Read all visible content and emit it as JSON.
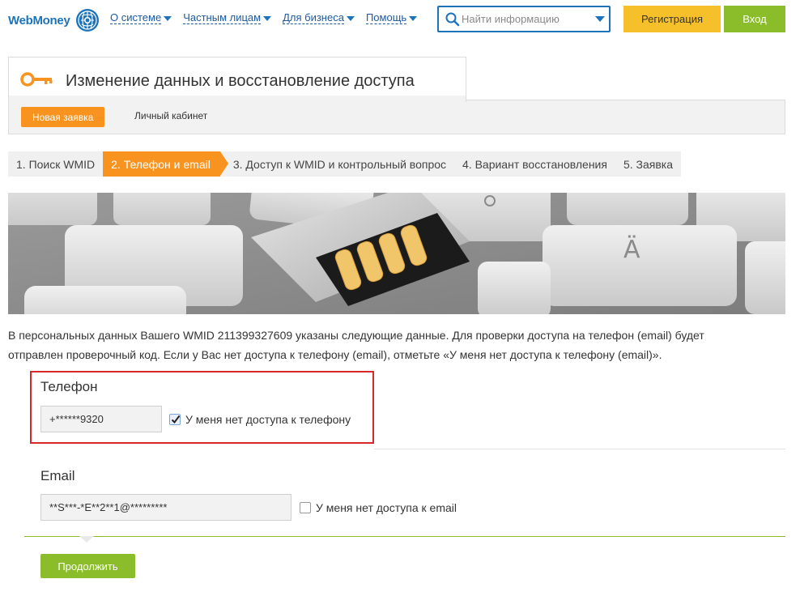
{
  "header": {
    "logo_text": "WebMoney",
    "nav": [
      {
        "label": "О системе"
      },
      {
        "label": "Частным лицам"
      },
      {
        "label": "Для бизнеса"
      },
      {
        "label": "Помощь"
      }
    ],
    "search_placeholder": "Найти информацию",
    "register_label": "Регистрация",
    "login_label": "Вход"
  },
  "page": {
    "title": "Изменение данных и восстановление доступа",
    "tabs": [
      {
        "label": "Новая заявка",
        "active": true
      },
      {
        "label": "Личный кабинет",
        "active": false
      }
    ]
  },
  "steps": [
    {
      "label": "1. Поиск WMID",
      "active": false
    },
    {
      "label": "2. Телефон и email",
      "active": true
    },
    {
      "label": "3. Доступ к WMID и контрольный вопрос",
      "active": false
    },
    {
      "label": "4. Вариант восстановления",
      "active": false
    },
    {
      "label": "5. Заявка",
      "active": false
    }
  ],
  "banner": {
    "key_letters": [
      "Ä"
    ]
  },
  "intro": {
    "line1": "В персональных данных Вашего WMID 211399327609 указаны следующие данные. Для проверки доступа на телефон (email) будет",
    "line2": "отправлен проверочный код. Если у Вас нет доступа к телефону (email), отметьте «У меня нет доступа к телефону (email)»."
  },
  "phone": {
    "title": "Телефон",
    "value": "+******9320",
    "no_access_label": "У меня нет доступа к телефону",
    "no_access_checked": true
  },
  "email": {
    "title": "Email",
    "value": "**S***-*E**2**1@*********",
    "no_access_label": "У меня нет доступа к email",
    "no_access_checked": false
  },
  "continue_label": "Продолжить",
  "colors": {
    "brand_blue": "#1d73b9",
    "accent_orange": "#f7931e",
    "green": "#8bbd2b",
    "yellow": "#f6c02a",
    "highlight_red": "#d8282a"
  }
}
